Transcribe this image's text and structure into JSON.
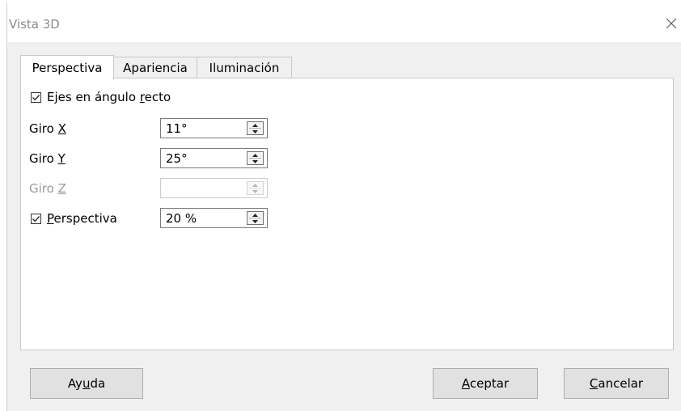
{
  "window": {
    "title": "Vista 3D"
  },
  "tabs": [
    {
      "label": "Perspectiva",
      "active": true
    },
    {
      "label": "Apariencia",
      "active": false
    },
    {
      "label": "Iluminación",
      "active": false
    }
  ],
  "fields": {
    "right_angle": {
      "label_before": "Ejes en ángulo ",
      "mnemonic": "r",
      "label_after": "ecto",
      "checked": true
    },
    "rot_x": {
      "label_before": "Giro ",
      "mnemonic": "X",
      "value": "11°",
      "enabled": true
    },
    "rot_y": {
      "label_before": "Giro ",
      "mnemonic": "Y",
      "value": "25°",
      "enabled": true
    },
    "rot_z": {
      "label_before": "Giro ",
      "mnemonic": "Z",
      "value": "",
      "enabled": false
    },
    "perspective": {
      "mnemonic": "P",
      "label_after": "erspectiva",
      "value": "20 %",
      "checked": true
    }
  },
  "buttons": {
    "help": {
      "before": "Ay",
      "mnemonic": "u",
      "after": "da"
    },
    "ok": {
      "mnemonic": "A",
      "after": "ceptar"
    },
    "cancel": {
      "mnemonic": "C",
      "after": "ancelar"
    }
  }
}
